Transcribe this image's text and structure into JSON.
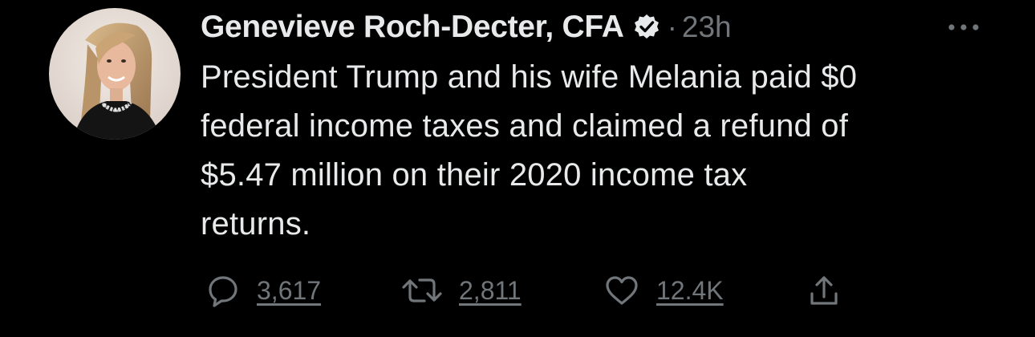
{
  "tweet": {
    "author": {
      "display_name": "Genevieve Roch-Decter, CFA",
      "verified_icon": "verified-badge-icon",
      "avatar": "profile-photo"
    },
    "separator": "·",
    "time": "23h",
    "text": "President Trump and his wife Melania paid $0 federal income taxes and claimed a refund of $5.47 million on their 2020 income tax returns.",
    "text_lines": [
      "President Trump and his wife Melania paid $0",
      "federal income taxes and claimed a refund of",
      "$5.47 million on their 2020 income tax",
      "returns."
    ],
    "more_icon": "more-options-icon",
    "actions": {
      "reply": {
        "icon": "reply-icon",
        "count": "3,617"
      },
      "retweet": {
        "icon": "retweet-icon",
        "count": "2,811"
      },
      "like": {
        "icon": "like-icon",
        "count": "12.4K"
      },
      "share": {
        "icon": "share-icon"
      }
    }
  },
  "colors": {
    "background": "#000000",
    "primary_text": "#e7e9ea",
    "secondary_text": "#71767b"
  }
}
